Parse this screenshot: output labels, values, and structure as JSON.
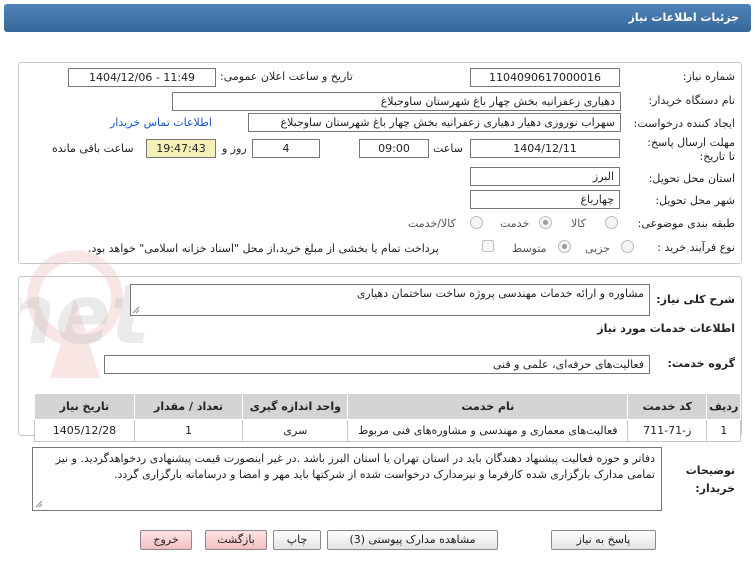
{
  "header": {
    "title": "جزئیات اطلاعات نیاز"
  },
  "fields": {
    "need_number_label": "شماره نیاز:",
    "need_number": "1104090617000016",
    "announce_label": "تاریخ و ساعت اعلان عمومی:",
    "announce_value": "1404/12/06 - 11:49",
    "buyer_org_label": "نام دستگاه خریدار:",
    "buyer_org": "دهیاری زعفرانیه  بخش چهار باغ شهرستان ساوجبلاغ",
    "creator_label": "ایجاد کننده درخواست:",
    "creator": "سهراب نوروزی دهیار دهیاری زعفرانیه  بخش چهار باغ شهرستان ساوجبلاغ",
    "contact_link": "اطلاعات تماس خریدار",
    "deadline_label": "مهلت ارسال پاسخ: تا تاریخ:",
    "deadline_date": "1404/12/11",
    "time_label": "ساعت",
    "deadline_time": "09:00",
    "days_value": "4",
    "days_label": "روز و",
    "remaining_time": "19:47:43",
    "remaining_label": "ساعت باقی مانده",
    "province_label": "استان محل تحویل:",
    "province": "البرز",
    "city_label": "شهر محل تحویل:",
    "city": "چهارباغ",
    "category_label": "طبقه بندی موضوعی:",
    "category_options": [
      "کالا",
      "خدمت",
      "کالا/خدمت"
    ],
    "process_label": "نوع فرآیند خرید :",
    "process_options": [
      "جزیی",
      "متوسط"
    ],
    "treasury_note": "پرداخت تمام یا بخشی از مبلغ خرید،از محل \"اسناد خزانه اسلامی\" خواهد بود."
  },
  "summary": {
    "label": "شرح کلی نیاز:",
    "value": "مشاوره و ارائه خدمات مهندسی پروژه ساخت ساختمان دهیاری"
  },
  "services_section": {
    "title": "اطلاعات خدمات مورد نیاز",
    "group_label": "گروه خدمت:",
    "group_value": "فعالیت‌های حرفه‌ای، علمی و فنی"
  },
  "table": {
    "headers": [
      "ردیف",
      "کد خدمت",
      "نام خدمت",
      "واحد اندازه گیری",
      "تعداد / مقدار",
      "تاریخ نیاز"
    ],
    "rows": [
      [
        "1",
        "ز-71-711",
        "فعالیت‌های معماری و مهندسی و مشاوره‌های فنی مربوط",
        "سری",
        "1",
        "1405/12/28"
      ]
    ]
  },
  "buyer_notes": {
    "label": "توضیحات خریدار:",
    "text": "دفاتر و حوزه فعالیت پیشنهاد دهندگان باید در استان تهران یا استان البرز باشد .در غیر اینصورت قیمت پیشنهادی ردخواهدگردید. و نیز تمامی مدارک بارگزاری شده کارفرما و نیزمدارک درخواست شده از شرکتها باید مهر و امضا و درسامانه بارگزاری گردد."
  },
  "buttons": {
    "reply": "پاسخ به نیاز",
    "attachments": "مشاهده مدارک پیوستی (3)",
    "print": "چاپ",
    "back": "بازگشت",
    "exit": "خروج"
  },
  "watermark": {
    "text": "AriaTender.net"
  }
}
